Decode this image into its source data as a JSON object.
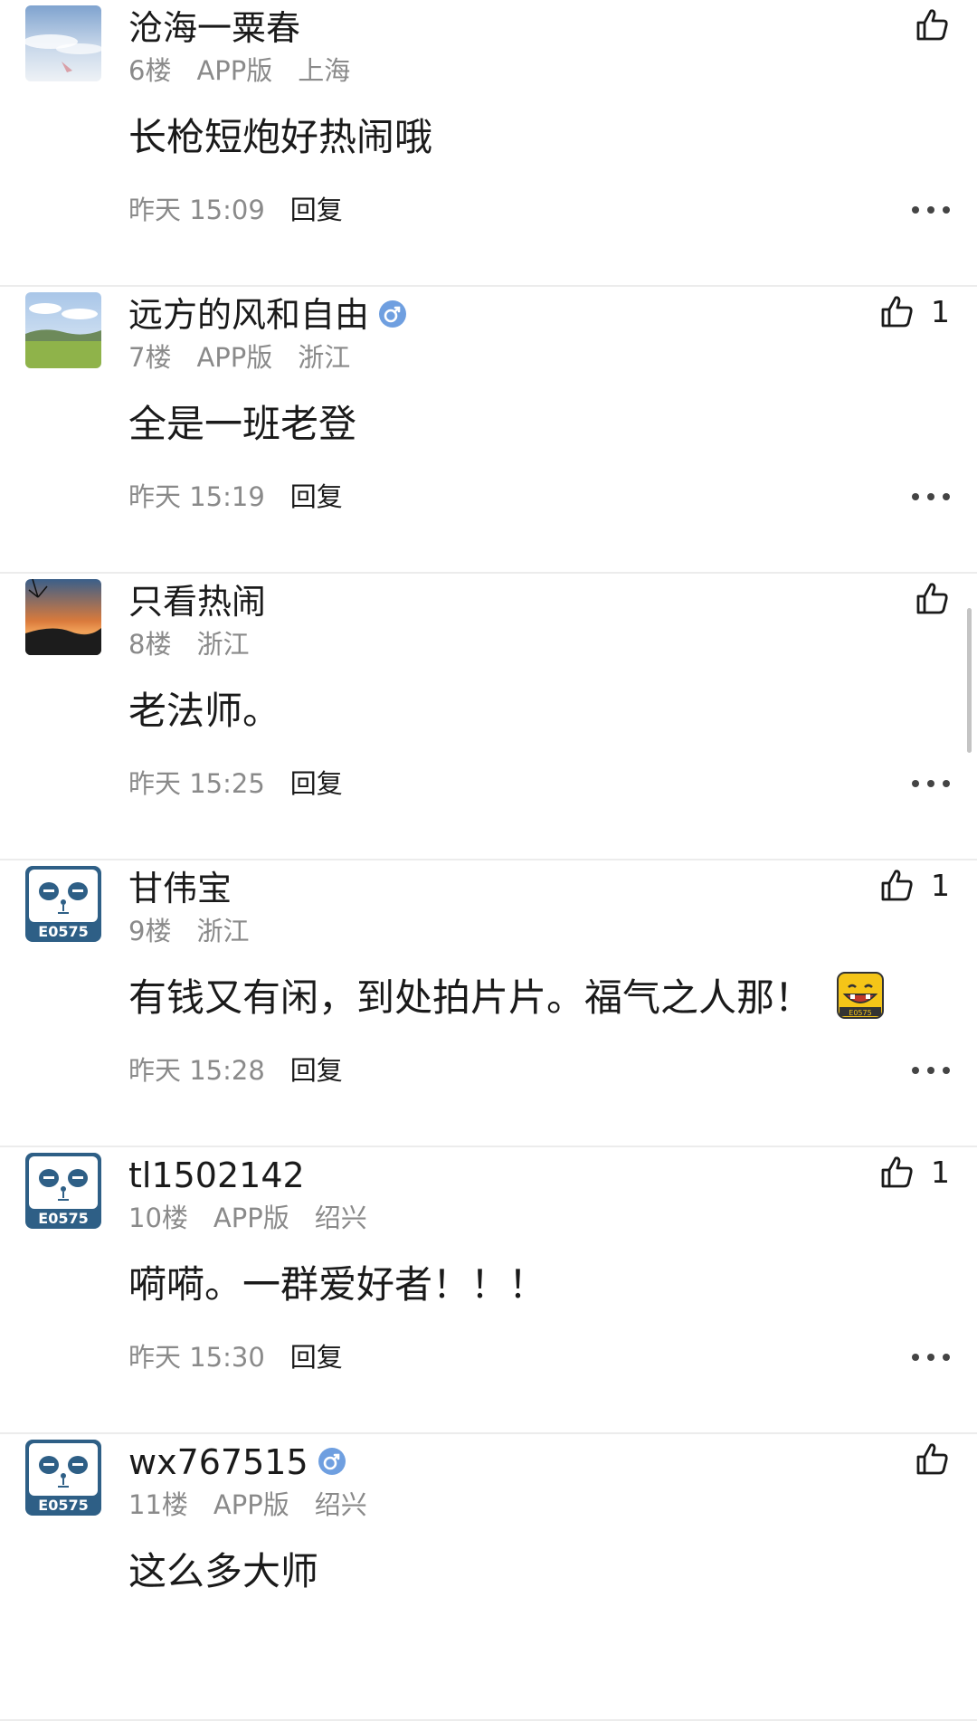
{
  "comments": [
    {
      "username": "沧海一粟春",
      "floor": "6楼",
      "client": "APP版",
      "region": "上海",
      "content": "长枪短炮好热闹哦",
      "time": "昨天 15:09",
      "reply_label": "回复",
      "likes": "",
      "verified": false,
      "avatar": "avatar-sky",
      "emoji": ""
    },
    {
      "username": "远方的风和自由",
      "floor": "7楼",
      "client": "APP版",
      "region": "浙江",
      "content": "全是一班老登",
      "time": "昨天 15:19",
      "reply_label": "回复",
      "likes": "1",
      "verified": true,
      "avatar": "avatar-field",
      "emoji": ""
    },
    {
      "username": "只看热闹",
      "floor": "8楼",
      "client": "",
      "region": "浙江",
      "content": "老法师。",
      "time": "昨天 15:25",
      "reply_label": "回复",
      "likes": "",
      "verified": false,
      "avatar": "avatar-sunset",
      "emoji": ""
    },
    {
      "username": "甘伟宝",
      "floor": "9楼",
      "client": "",
      "region": "浙江",
      "content": "有钱又有闲，到处拍片片。福气之人那！",
      "time": "昨天 15:28",
      "reply_label": "回复",
      "likes": "1",
      "verified": false,
      "avatar": "avatar-panda",
      "emoji": "laugh-emoji"
    },
    {
      "username": "tl1502142",
      "floor": "10楼",
      "client": "APP版",
      "region": "绍兴",
      "content": "嗬嗬。一群爱好者！！！",
      "time": "昨天 15:30",
      "reply_label": "回复",
      "likes": "1",
      "verified": false,
      "avatar": "avatar-panda",
      "emoji": ""
    },
    {
      "username": "wx767515",
      "floor": "11楼",
      "client": "APP版",
      "region": "绍兴",
      "content": "这么多大师",
      "time": "",
      "reply_label": "",
      "likes": "",
      "verified": true,
      "avatar": "avatar-panda",
      "emoji": ""
    }
  ],
  "panda_logo_text": "E0575",
  "colors": {
    "text": "#1a1a1a",
    "meta": "#8a8a8a",
    "divider": "#ececec",
    "badge": "#6f9fe0"
  }
}
